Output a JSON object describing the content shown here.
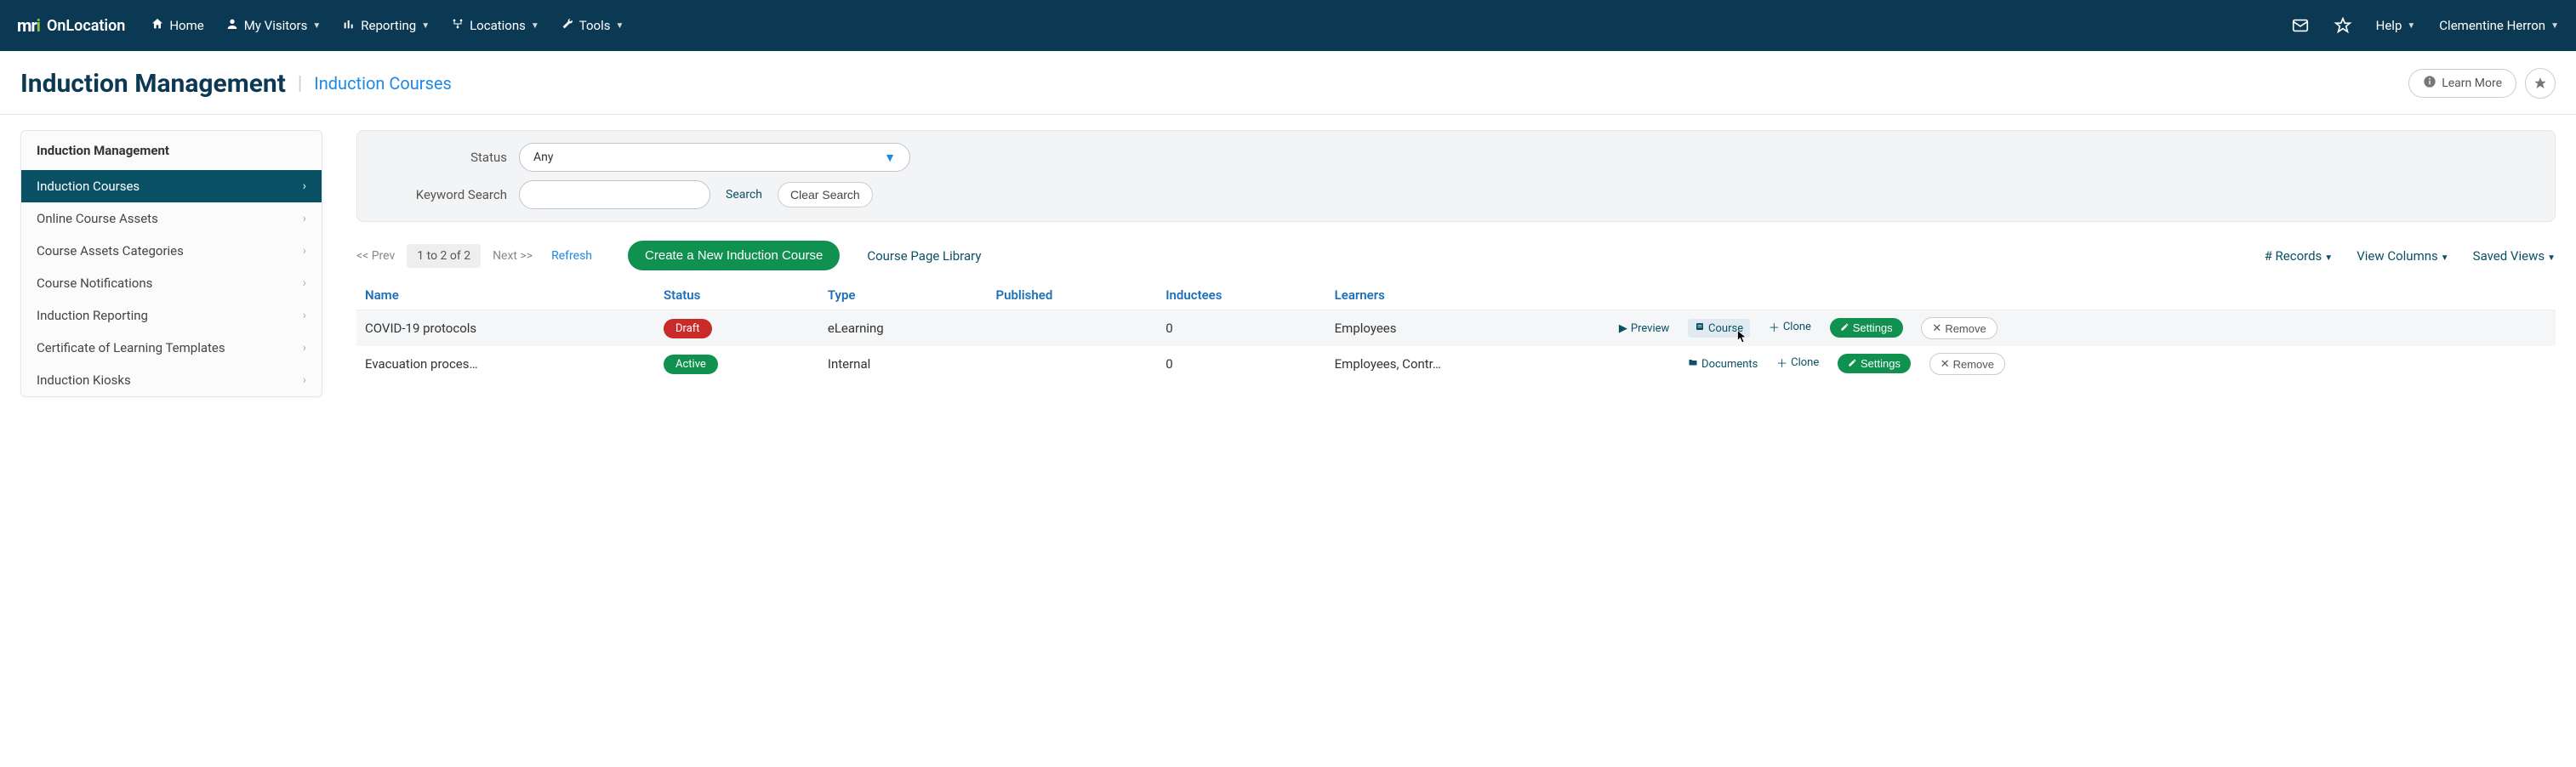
{
  "brand": {
    "logo_prefix": "mr",
    "logo_suffix": "i",
    "name": "OnLocation"
  },
  "topnav": {
    "items": [
      {
        "label": "Home"
      },
      {
        "label": "My Visitors"
      },
      {
        "label": "Reporting"
      },
      {
        "label": "Locations"
      },
      {
        "label": "Tools"
      }
    ],
    "help": "Help",
    "user": "Clementine Herron"
  },
  "page": {
    "title": "Induction Management",
    "subtitle": "Induction Courses",
    "learn_more": "Learn More"
  },
  "sidebar": {
    "header": "Induction Management",
    "items": [
      {
        "label": "Induction Courses",
        "active": true
      },
      {
        "label": "Online Course Assets"
      },
      {
        "label": "Course Assets Categories"
      },
      {
        "label": "Course Notifications"
      },
      {
        "label": "Induction Reporting"
      },
      {
        "label": "Certificate of Learning Templates"
      },
      {
        "label": "Induction Kiosks"
      }
    ]
  },
  "filters": {
    "status_label": "Status",
    "status_value": "Any",
    "keyword_label": "Keyword Search",
    "search": "Search",
    "clear": "Clear Search"
  },
  "toolbar": {
    "prev": "<< Prev",
    "range": "1 to 2 of 2",
    "next": "Next >>",
    "refresh": "Refresh",
    "create": "Create a New Induction Course",
    "library": "Course Page Library",
    "records": "# Records",
    "columns": "View Columns",
    "saved": "Saved Views"
  },
  "table": {
    "headers": [
      "Name",
      "Status",
      "Type",
      "Published",
      "Inductees",
      "Learners"
    ],
    "rows": [
      {
        "name": "COVID-19 protocols",
        "status": "Draft",
        "status_class": "draft",
        "type": "eLearning",
        "published": "",
        "inductees": "0",
        "learners": "Employees",
        "preview": "Preview",
        "docs": "Course",
        "clone": "Clone",
        "settings": "Settings",
        "remove": "Remove"
      },
      {
        "name": "Evacuation proces…",
        "status": "Active",
        "status_class": "active",
        "type": "Internal",
        "published": "",
        "inductees": "0",
        "learners": "Employees, Contr…",
        "preview": "",
        "docs": "Documents",
        "clone": "Clone",
        "settings": "Settings",
        "remove": "Remove"
      }
    ]
  }
}
